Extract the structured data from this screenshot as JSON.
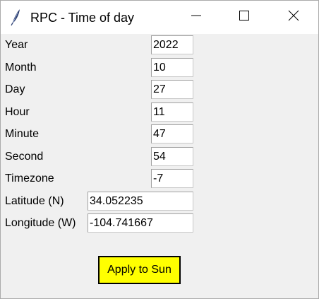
{
  "window": {
    "title": "RPC - Time of day",
    "icon": "feather-icon"
  },
  "titlebar_buttons": {
    "minimize_icon": "minimize-icon",
    "maximize_icon": "maximize-icon",
    "close_icon": "close-icon"
  },
  "fields": {
    "year": {
      "label": "Year",
      "value": "2022"
    },
    "month": {
      "label": "Month",
      "value": "10"
    },
    "day": {
      "label": "Day",
      "value": "27"
    },
    "hour": {
      "label": "Hour",
      "value": "11"
    },
    "minute": {
      "label": "Minute",
      "value": "47"
    },
    "second": {
      "label": "Second",
      "value": "54"
    },
    "timezone": {
      "label": "Timezone",
      "value": "-7"
    },
    "latitude": {
      "label": "Latitude (N)",
      "value": "34.052235"
    },
    "longitude": {
      "label": "Longitude (W)",
      "value": "-104.741667"
    }
  },
  "actions": {
    "apply_label": "Apply to Sun",
    "apply_color": "#ffff00"
  }
}
